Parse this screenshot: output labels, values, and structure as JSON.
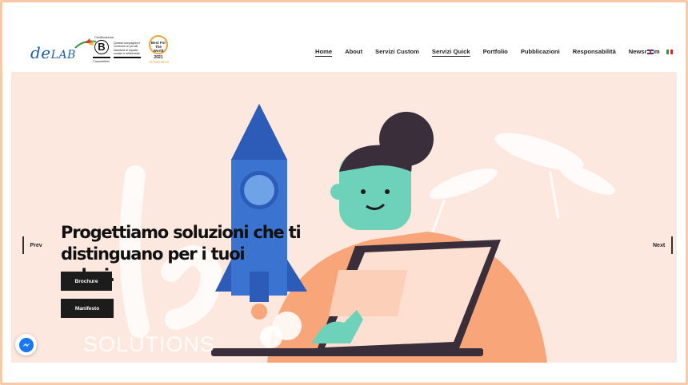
{
  "brand": {
    "logo_main": "de",
    "logo_sub": "LAB",
    "bcorp_top": "Certificazione",
    "bcorp_letter": "B",
    "bcorp_bottom": "Corporation",
    "bcorp_desc": "Questa compagnia è conforme ai più alti standard di impatto sociale e ambientale",
    "best_badge": "Best For The World",
    "best_year": "2021",
    "best_category": "Governance"
  },
  "nav": {
    "items": [
      {
        "label": "Home",
        "active": true
      },
      {
        "label": "About",
        "active": false
      },
      {
        "label": "Servizi Custom",
        "active": false
      },
      {
        "label": "Servizi Quick",
        "active": true
      },
      {
        "label": "Portfolio",
        "active": false
      },
      {
        "label": "Pubblicazioni",
        "active": false
      },
      {
        "label": "Responsabilità",
        "active": false
      },
      {
        "label": "Newsroom",
        "active": false
      }
    ],
    "lang_en": "english-flag-icon",
    "lang_it": "italian-flag-icon"
  },
  "hero": {
    "headline_line1": "Progettiamo soluzioni che ti",
    "headline_line2": "distinguano per i tuoi valori.",
    "btn_brochure": "Brochure",
    "btn_manifesto": "Manifesto",
    "watermark": "SOLUTIONS",
    "prev_label": "Prev",
    "next_label": "Next"
  },
  "colors": {
    "hero_bg": "#fde8df",
    "accent_peach": "#f8a57a",
    "rocket_blue": "#3b73d1",
    "skin_teal": "#6ed2bb",
    "dark": "#1c1c1c",
    "frame": "#f8c9a6"
  },
  "widget": {
    "icon": "messenger-icon"
  }
}
